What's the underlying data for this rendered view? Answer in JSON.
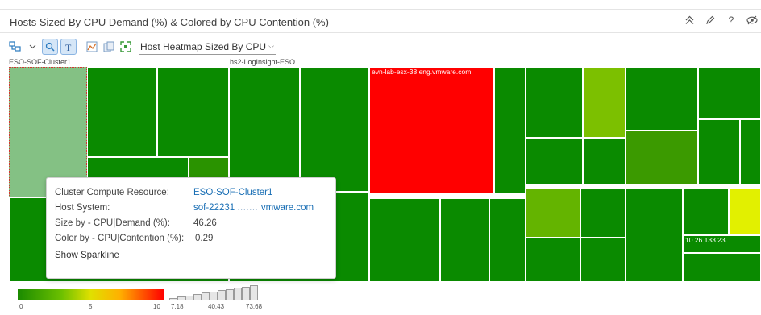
{
  "panel": {
    "title": "Hosts Sized By CPU Demand (%) & Colored by CPU Contention (%)",
    "actions": [
      {
        "name": "collapse-icon",
        "glyph": "⌃⌃"
      },
      {
        "name": "edit-icon",
        "glyph": "✎"
      },
      {
        "name": "help-icon",
        "glyph": "?"
      },
      {
        "name": "hide-icon",
        "glyph": "◎"
      }
    ]
  },
  "toolbar": {
    "view_select": "Host Heatmap Sized By CPU"
  },
  "groups": [
    {
      "label": "ESO-SOF-Cluster1"
    },
    {
      "label": "hs2-LogInsight-ESO"
    }
  ],
  "cells": [
    {
      "name": "host-cell",
      "color": "#84c184",
      "label": "",
      "selected": true
    },
    {
      "name": "host-cell",
      "color": "#0a8a00",
      "label": ""
    },
    {
      "name": "host-cell",
      "color": "#0a8a00",
      "label": ""
    },
    {
      "name": "host-cell",
      "color": "#0a8a00",
      "label": ""
    },
    {
      "name": "host-cell",
      "color": "#2a9300",
      "label": ""
    },
    {
      "name": "host-cell",
      "color": "#0a8a00",
      "label": ""
    },
    {
      "name": "host-cell",
      "color": "#0a8a00",
      "label": ""
    },
    {
      "name": "host-cell",
      "color": "#0a8a00",
      "label": ""
    },
    {
      "name": "host-cell",
      "color": "#0a8a00",
      "label": ""
    },
    {
      "name": "host-cell",
      "color": "#ff0000",
      "label": "evn-lab-esx-38.eng.vmware.com"
    },
    {
      "name": "host-cell",
      "color": "#0a8a00",
      "label": ""
    },
    {
      "name": "host-cell",
      "color": "#0a8a00",
      "label": ""
    },
    {
      "name": "host-cell",
      "color": "#7cc000",
      "label": ""
    },
    {
      "name": "host-cell",
      "color": "#0a8a00",
      "label": ""
    },
    {
      "name": "host-cell",
      "color": "#0a8a00",
      "label": ""
    },
    {
      "name": "host-cell",
      "color": "#0a8a00",
      "label": ""
    },
    {
      "name": "host-cell",
      "color": "#0a8a00",
      "label": ""
    },
    {
      "name": "host-cell",
      "color": "#3b9a00",
      "label": ""
    },
    {
      "name": "host-cell",
      "color": "#0a8a00",
      "label": ""
    },
    {
      "name": "host-cell",
      "color": "#0a8a00",
      "label": ""
    },
    {
      "name": "host-cell",
      "color": "#0a8a00",
      "label": ""
    },
    {
      "name": "host-cell",
      "color": "#0a8a00",
      "label": ""
    },
    {
      "name": "host-cell",
      "color": "#0a8a00",
      "label": ""
    },
    {
      "name": "host-cell",
      "color": "#64b400",
      "label": ""
    },
    {
      "name": "host-cell",
      "color": "#0a8a00",
      "label": ""
    },
    {
      "name": "host-cell",
      "color": "#0a8a00",
      "label": ""
    },
    {
      "name": "host-cell",
      "color": "#0a8a00",
      "label": ""
    },
    {
      "name": "host-cell",
      "color": "#0a8a00",
      "label": ""
    },
    {
      "name": "host-cell",
      "color": "#0a8a00",
      "label": ""
    },
    {
      "name": "host-cell",
      "color": "#e2f000",
      "label": ""
    },
    {
      "name": "host-cell",
      "color": "#0a8a00",
      "label": "10.26.133.23"
    },
    {
      "name": "host-cell",
      "color": "#0a8a00",
      "label": ""
    },
    {
      "name": "host-cell",
      "color": "#1f9000",
      "label": ""
    },
    {
      "name": "host-cell",
      "color": "#0a8a00",
      "label": ""
    },
    {
      "name": "host-cell",
      "color": "#0a8a00",
      "label": ""
    },
    {
      "name": "host-cell",
      "color": "#0a8a00",
      "label": ""
    },
    {
      "name": "host-cell",
      "color": "#4ca600",
      "label": ""
    }
  ],
  "tooltip": {
    "rows": [
      {
        "key": "Cluster Compute Resource:",
        "value": "ESO-SOF-Cluster1",
        "link": true
      },
      {
        "key": "Host System:",
        "value": "sof-22231",
        "value_blurred": "....... ",
        "value_tail": "vmware.com",
        "link": true
      },
      {
        "key": "Size by - CPU|Demand (%):",
        "value": "46.26",
        "link": false
      },
      {
        "key": "Color by - CPU|Contention (%):",
        "value": "0.29",
        "link": false
      }
    ],
    "sparkline_link": "Show Sparkline"
  },
  "legend": {
    "color_ticks": [
      "0",
      "5",
      "10"
    ],
    "size_ticks": [
      "7.18",
      "40.43",
      "73.68"
    ],
    "size_levels": [
      0.15,
      0.25,
      0.33,
      0.42,
      0.5,
      0.58,
      0.67,
      0.75,
      0.83,
      0.92,
      1.0
    ]
  }
}
